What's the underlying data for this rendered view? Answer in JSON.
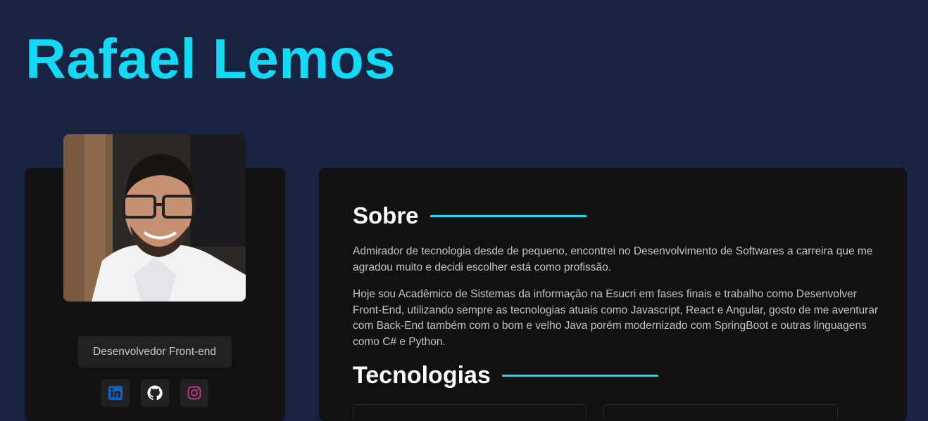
{
  "header": {
    "title": "Rafael Lemos"
  },
  "profile": {
    "role": "Desenvolvedor Front-end",
    "social": [
      {
        "icon": "linkedin-icon",
        "color": "#0a66c2"
      },
      {
        "icon": "github-icon",
        "color": "#ffffff"
      },
      {
        "icon": "instagram-icon",
        "color": "#c13584"
      }
    ]
  },
  "about": {
    "heading": "Sobre",
    "paragraphs": [
      "Admirador de tecnologia desde de pequeno, encontrei no Desenvolvimento de Softwares a carreira que me agradou muito e decidi escolher está como profissão.",
      "Hoje sou Acadêmico de Sistemas da informação na Esucri em fases finais e trabalho como Desenvolver Front-End, utilizando sempre as tecnologias atuais como Javascript, React e Angular, gosto de me aventurar com Back-End também com o bom e velho Java porém modernizado com SpringBoot e outras linguagens como C# e Python."
    ]
  },
  "technologies": {
    "heading": "Tecnologias"
  },
  "colors": {
    "background": "#172340",
    "card": "#111111",
    "accent": "#14d9f5"
  }
}
